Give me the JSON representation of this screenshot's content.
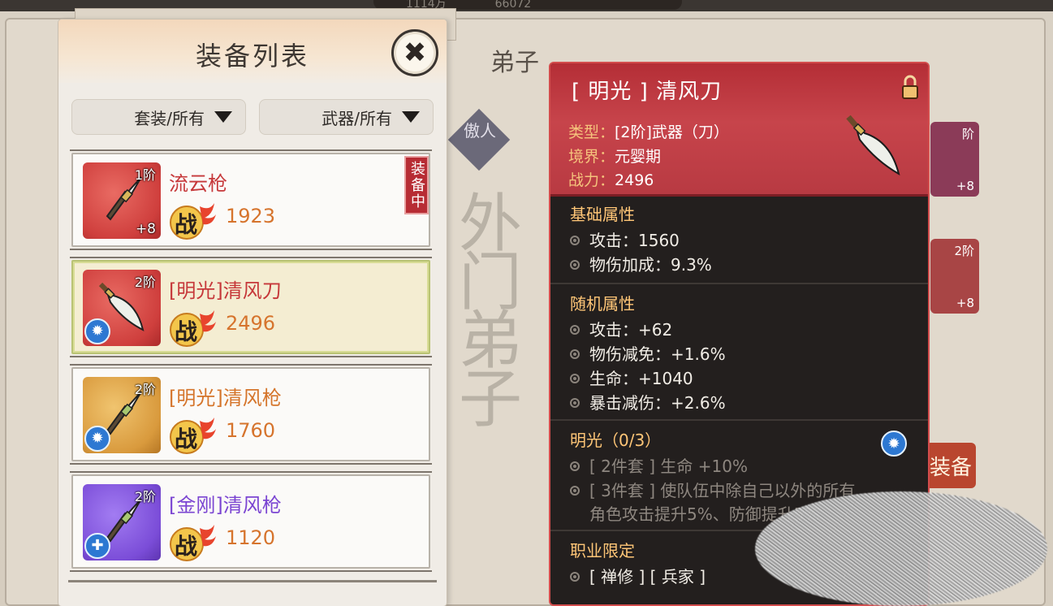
{
  "top_bar": {
    "value_a": "1114万",
    "value_b": "66072"
  },
  "background": {
    "title": "弟子",
    "diamond_label": "傲人",
    "big_text": "外门弟子",
    "card_one": {
      "tier": "阶",
      "plus": "+8"
    },
    "card_two": {
      "tier": "2阶",
      "plus": "+8"
    },
    "equip_button": "装备"
  },
  "panel": {
    "title": "装备列表",
    "close_icon": "close-icon",
    "filters": [
      {
        "label": "套装/所有"
      },
      {
        "label": "武器/所有"
      }
    ],
    "items": [
      {
        "name": "流云枪",
        "tier": "1阶",
        "plus": "+8",
        "power": "1923",
        "equipped": "装备中",
        "color": "red",
        "weapon": "spear"
      },
      {
        "name": "[明光]清风刀",
        "tier": "2阶",
        "plus": "",
        "power": "2496",
        "selected": true,
        "set_icon": "sun-icon",
        "color": "red",
        "weapon": "blade"
      },
      {
        "name": "[明光]清风枪",
        "tier": "2阶",
        "plus": "",
        "power": "1760",
        "set_icon": "sun-icon",
        "color": "gold",
        "weapon": "spear"
      },
      {
        "name": "[金刚]清风枪",
        "tier": "2阶",
        "plus": "",
        "power": "1120",
        "set_icon": "shield-plus-icon",
        "color": "purple",
        "weapon": "spear"
      }
    ],
    "power_glyph": "战"
  },
  "detail": {
    "title": "[ 明光 ] 清风刀",
    "type_label": "类型：",
    "type_value": "[2阶]武器（刀）",
    "realm_label": "境界：",
    "realm_value": "元婴期",
    "power_label": "战力：",
    "power_value": "2496",
    "basic": {
      "title": "基础属性",
      "attrs": [
        "攻击：1560",
        "物伤加成：9.3%"
      ]
    },
    "random": {
      "title": "随机属性",
      "attrs": [
        "攻击：+62",
        "物伤减免：+1.6%",
        "生命：+1040",
        "暴击减伤：+2.6%"
      ]
    },
    "set": {
      "title": "明光（0/3）",
      "bonus_2": "[ 2件套 ] 生命 +10%",
      "bonus_3_line1": "[ 3件套 ] 使队伍中除自己以外的所有",
      "bonus_3_line2": "角色攻击提升5%、防御提升5%"
    },
    "job": {
      "title": "职业限定",
      "value": "[ 禅修 ] [ 兵家 ]"
    }
  },
  "colors": {
    "accent_red": "#c7444b",
    "power_orange": "#d6742d",
    "section_gold": "#ffc677",
    "set_blue": "#2d78d2"
  }
}
